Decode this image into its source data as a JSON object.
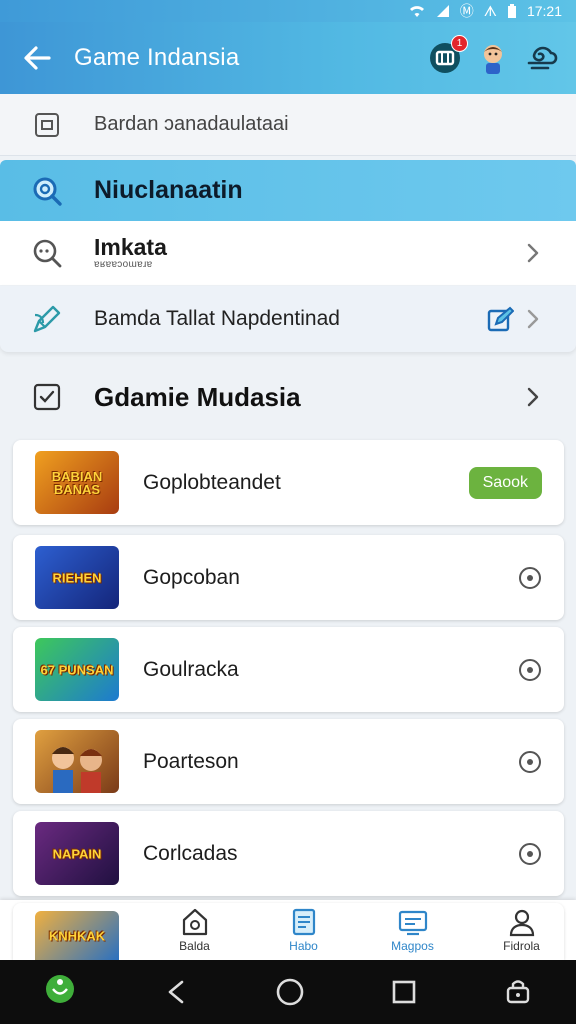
{
  "status_bar": {
    "carrier": "Ⓜ",
    "network": "ᗑ",
    "time": "17:21"
  },
  "header": {
    "title": "Game Indansia",
    "notification_count": "1"
  },
  "menu": {
    "top_item": {
      "label": "Bardan ɔanadaulataai"
    },
    "highlight_item": {
      "label": "Niuclanaatin"
    },
    "item_1": {
      "label": "Imkata",
      "sub": "ɐʁɐɐɔoɯɐɹɐ"
    },
    "item_2": {
      "label": "Bamda Tallat Napdentinad"
    }
  },
  "section": {
    "title": "Gdamie Mudasia"
  },
  "games": [
    {
      "name": "Goplobteandet",
      "thumb_text": "BABIAN BANAS",
      "action": "Saook",
      "bg": [
        "#f0a020",
        "#a83c10"
      ]
    },
    {
      "name": "Gopcoban",
      "thumb_text": "RIEHEN",
      "action": "",
      "bg": [
        "#2d5fd0",
        "#14257a"
      ]
    },
    {
      "name": "Goulracka",
      "thumb_text": "67 PUNSAN",
      "action": "",
      "bg": [
        "#3ec85a",
        "#1d7ad0"
      ]
    },
    {
      "name": "Poarteson",
      "thumb_text": "",
      "action": "",
      "bg": [
        "#e0a040",
        "#7a3a18"
      ]
    },
    {
      "name": "Corlcadas",
      "thumb_text": "NAPAIN",
      "action": "",
      "bg": [
        "#6a2a80",
        "#201040"
      ]
    }
  ],
  "peek_game": {
    "thumb_text": "KNHKAK"
  },
  "bottom_nav": [
    {
      "label": "Balda",
      "icon": "home-icon"
    },
    {
      "label": "Habo",
      "icon": "document-icon"
    },
    {
      "label": "Magpos",
      "icon": "cart-icon"
    },
    {
      "label": "Fidrola",
      "icon": "profile-icon"
    }
  ],
  "colors": {
    "accent": "#3e96d6",
    "highlight": "#59bde6",
    "success": "#6cb33f"
  }
}
